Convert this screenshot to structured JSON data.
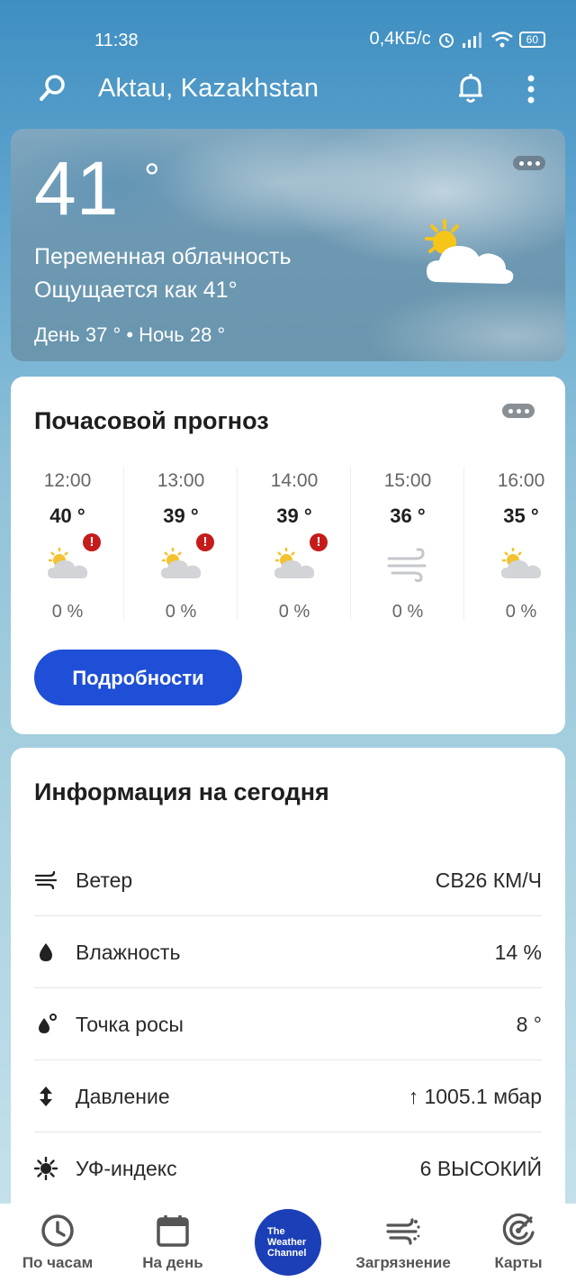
{
  "status_bar": {
    "time": "11:38",
    "speed": "0,4КБ/с",
    "battery": "60"
  },
  "header": {
    "location": "Aktau, Kazakhstan",
    "icons": [
      "search-icon",
      "bell-icon",
      "more-vert-icon"
    ]
  },
  "current": {
    "temp": "41",
    "degree": "°",
    "condition": "Переменная облачность",
    "feels_like": "Ощущается как 41°",
    "day_night": "День 37 ° • Ночь 28 °",
    "icon": "partly-cloudy-icon"
  },
  "hourly": {
    "title": "Почасовой прогноз",
    "details_button": "Подробности",
    "hours": [
      {
        "time": "12:00",
        "temp": "40 °",
        "precip": "0 %",
        "icon": "partly-cloudy-icon",
        "alert": true
      },
      {
        "time": "13:00",
        "temp": "39 °",
        "precip": "0 %",
        "icon": "partly-cloudy-icon",
        "alert": true
      },
      {
        "time": "14:00",
        "temp": "39 °",
        "precip": "0 %",
        "icon": "partly-cloudy-icon",
        "alert": true
      },
      {
        "time": "15:00",
        "temp": "36 °",
        "precip": "0 %",
        "icon": "wind-icon",
        "alert": false
      },
      {
        "time": "16:00",
        "temp": "35 °",
        "precip": "0 %",
        "icon": "partly-cloudy-icon",
        "alert": false
      }
    ],
    "alert_symbol": "!"
  },
  "today": {
    "title": "Информация на сегодня",
    "rows": [
      {
        "label": "Ветер",
        "value": "СВ26 КМ/Ч",
        "icon": "wind-icon"
      },
      {
        "label": "Влажность",
        "value": "14 %",
        "icon": "humidity-drop-icon"
      },
      {
        "label": "Точка росы",
        "value": "8 °",
        "icon": "dew-point-icon"
      },
      {
        "label": "Давление",
        "value": "↑ 1005.1 мбар",
        "icon": "pressure-icon"
      },
      {
        "label": "УФ-индекс",
        "value": "6 ВЫСОКИЙ",
        "icon": "uv-sun-icon"
      }
    ]
  },
  "nav": {
    "items": [
      {
        "label": "По часам",
        "icon": "clock-icon"
      },
      {
        "label": "На день",
        "icon": "calendar-icon"
      },
      {
        "label": "The Weather Channel",
        "icon": "twc-logo"
      },
      {
        "label": "Загрязнение",
        "icon": "air-quality-icon"
      },
      {
        "label": "Карты",
        "icon": "radar-icon"
      }
    ],
    "logo_lines": [
      "The",
      "Weather",
      "Channel"
    ]
  },
  "colors": {
    "accent": "#1f4fd6",
    "alert": "#c61b1b",
    "logo": "#1b3fb7"
  }
}
